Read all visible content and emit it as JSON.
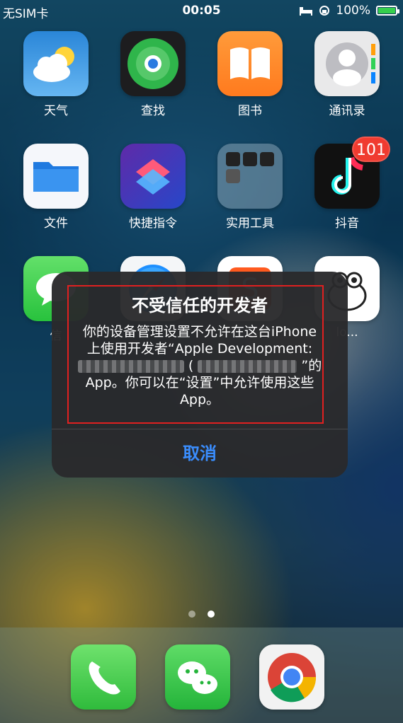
{
  "status_bar": {
    "carrier": "无SIM卡",
    "time": "00:05",
    "battery_percent": "100%"
  },
  "apps": [
    {
      "name": "weather",
      "label": "天气"
    },
    {
      "name": "findmy",
      "label": "查找"
    },
    {
      "name": "books",
      "label": "图书"
    },
    {
      "name": "contacts",
      "label": "通讯录"
    },
    {
      "name": "files",
      "label": "文件"
    },
    {
      "name": "shortcuts",
      "label": "快捷指令"
    },
    {
      "name": "folder",
      "label": "实用工具"
    },
    {
      "name": "tiktok",
      "label": "抖音",
      "badge": "101"
    },
    {
      "name": "messages",
      "label": "信"
    },
    {
      "name": "safari",
      "label": ""
    },
    {
      "name": "sogou",
      "label": ""
    },
    {
      "name": "bee",
      "label": "lo..."
    }
  ],
  "alert": {
    "title": "不受信任的开发者",
    "line1": "你的设备管理设置不允许在这台iPhone",
    "line2": "上使用开发者“Apple Development:",
    "line3_suffix": "”的",
    "line4": "App。你可以在“设置”中允许使用这些",
    "line5": "App。",
    "cancel": "取消"
  },
  "dock": [
    "phone",
    "wechat",
    "chrome"
  ],
  "colors": {
    "accent": "#3a8dfd",
    "badge": "#f03b30",
    "highlight": "#e02020"
  }
}
